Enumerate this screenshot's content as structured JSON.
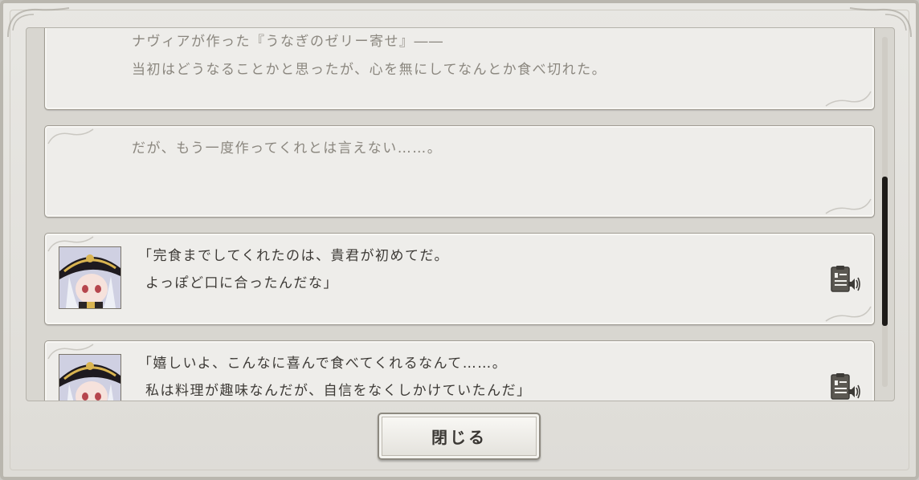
{
  "log": {
    "entries": [
      {
        "kind": "narration",
        "lines": [
          "ナヴィアが作った『うなぎのゼリー寄せ』――",
          "当初はどうなることかと思ったが、心を無にしてなんとか食べ切れた。"
        ]
      },
      {
        "kind": "narration",
        "lines": [
          "だが、もう一度作ってくれとは言えない……。"
        ]
      },
      {
        "kind": "speech",
        "lines": [
          "「完食までしてくれたのは、貴君が初めてだ。",
          "よっぽど口に合ったんだな」"
        ],
        "portrait": "navia-portrait",
        "voice_icon": "voice-replay-icon"
      },
      {
        "kind": "speech",
        "lines": [
          "「嬉しいよ、こんなに喜んで食べてくれるなんて……。",
          "私は料理が趣味なんだが、自信をなくしかけていたんだ」"
        ],
        "portrait": "navia-portrait",
        "voice_icon": "voice-replay-icon"
      }
    ]
  },
  "footer": {
    "close_label": "閉じる"
  },
  "colors": {
    "panel_bg": "#eeedea",
    "narration_text": "#8b877f",
    "speech_text": "#3d3a36",
    "scroll_thumb": "#1d1b18"
  }
}
